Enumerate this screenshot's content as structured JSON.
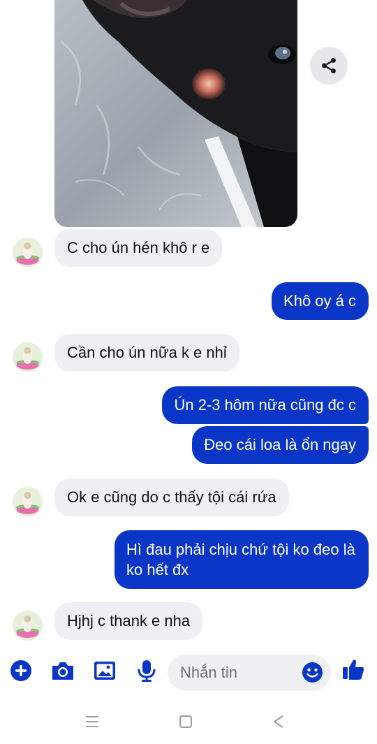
{
  "messages": [
    {
      "direction": "in",
      "text": "C cho ún hén khô r e"
    },
    {
      "direction": "out",
      "text": "Khô oy á c"
    },
    {
      "direction": "in",
      "text": "Cần cho ún nữa k e nhỉ"
    },
    {
      "direction": "out",
      "text": "Ún 2-3 hôm nữa cũng đc c"
    },
    {
      "direction": "out",
      "text": "Đeo cái loa là ổn ngay"
    },
    {
      "direction": "in",
      "text": "Ok e cũng do c thấy tội cái rứa"
    },
    {
      "direction": "out",
      "text": "Hì đau phải chịu chứ tội ko đeo là ko hết đx"
    },
    {
      "direction": "in",
      "text": "Hjhj c thank e nha"
    }
  ],
  "composer": {
    "placeholder": "Nhắn tin",
    "icons": [
      "plus-icon",
      "camera-icon",
      "gallery-icon",
      "microphone-icon",
      "emoji-icon",
      "thumbs-up-icon"
    ]
  },
  "navbar": {
    "icons": [
      "recent-apps-icon",
      "home-icon",
      "back-icon"
    ]
  },
  "colors": {
    "outgoing_bubble": "#0a36c7",
    "incoming_bubble": "#eff0f3",
    "accent": "#0a36c7"
  }
}
